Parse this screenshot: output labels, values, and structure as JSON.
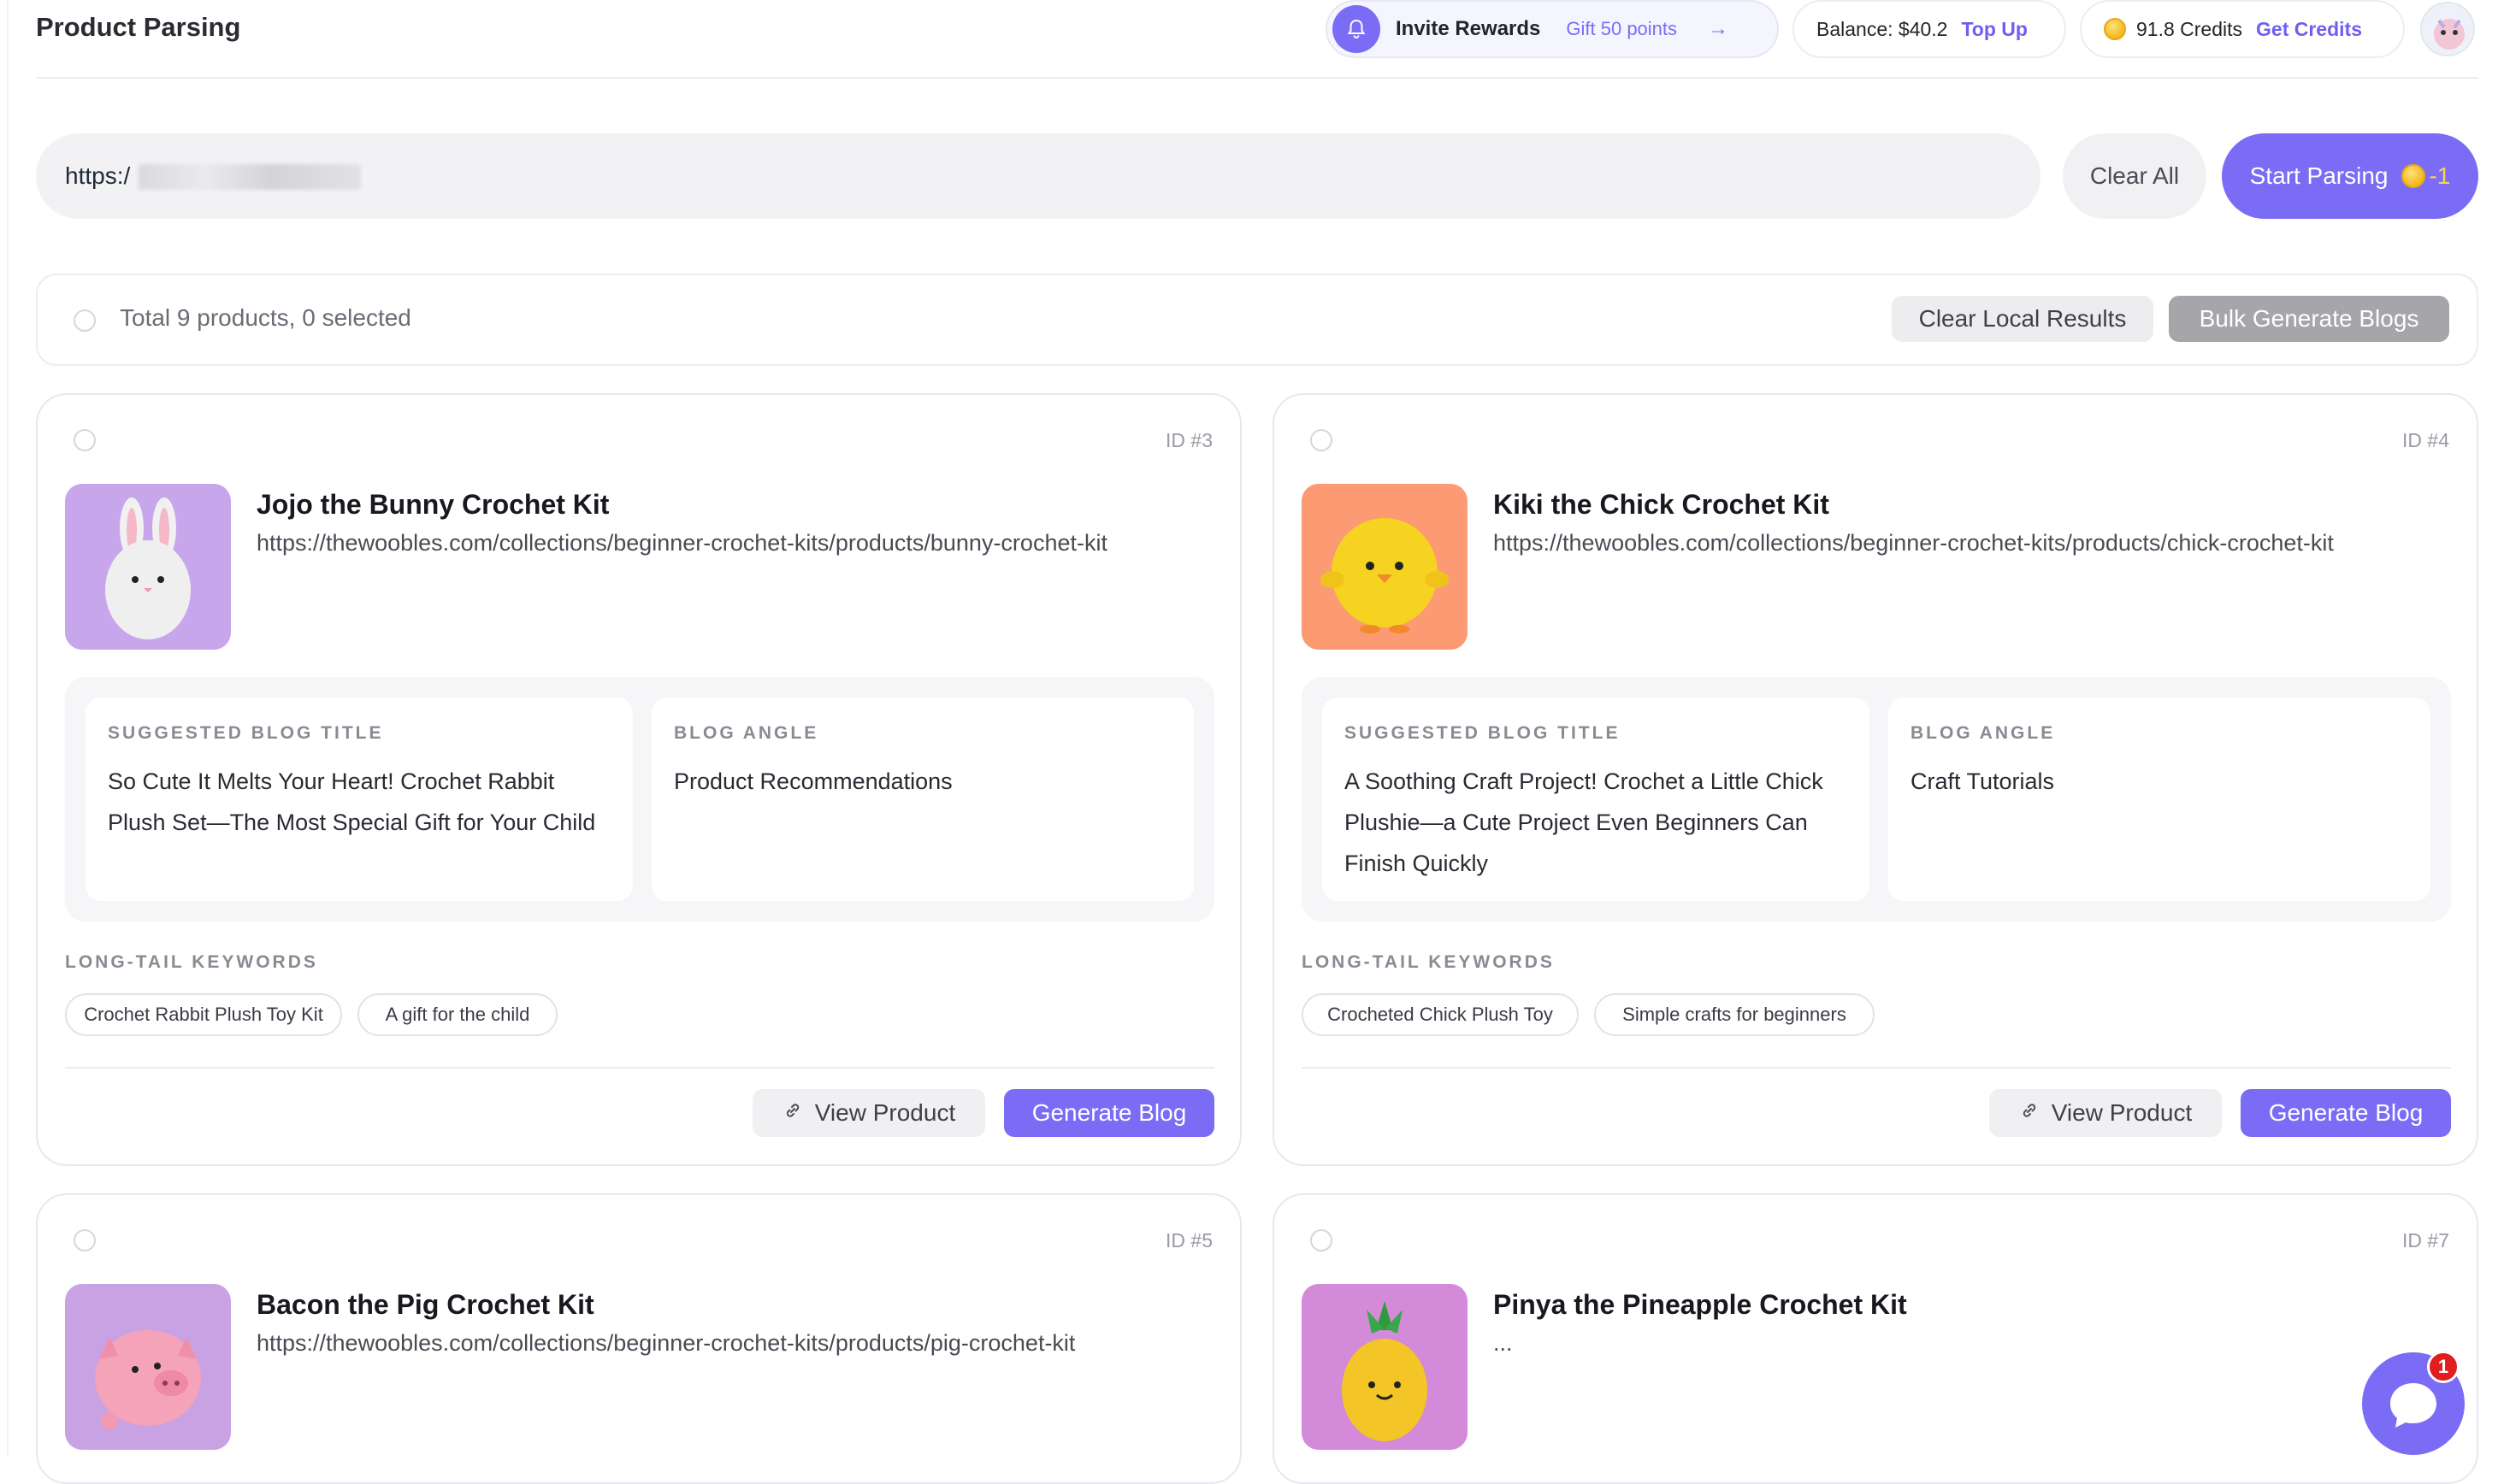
{
  "header": {
    "title": "Product Parsing",
    "invite": {
      "label": "Invite Rewards",
      "gift": "Gift 50 points"
    },
    "balance": {
      "text": "Balance: $40.2",
      "link": "Top Up"
    },
    "credits": {
      "text": "91.8 Credits",
      "link": "Get Credits"
    }
  },
  "url_bar": {
    "value": "https:/",
    "clear_all": "Clear All",
    "start_parsing": "Start Parsing",
    "cost": "-1"
  },
  "selection": {
    "summary": "Total 9 products, 0 selected",
    "clear_local": "Clear Local Results",
    "bulk_generate": "Bulk Generate Blogs"
  },
  "labels": {
    "suggested_blog_title": "SUGGESTED BLOG TITLE",
    "blog_angle": "BLOG ANGLE",
    "long_tail_keywords": "LONG-TAIL KEYWORDS",
    "view_product": "View Product",
    "generate_blog": "Generate Blog"
  },
  "products": [
    {
      "id_label": "ID #3",
      "name": "Jojo the Bunny Crochet Kit",
      "url": "https://thewoobles.com/collections/beginner-crochet-kits/products/bunny-crochet-kit",
      "suggested_title": "So Cute It Melts Your Heart! Crochet Rabbit Plush Set—The Most Special Gift for Your Child",
      "angle": "Product Recommendations",
      "keywords": [
        "Crochet Rabbit Plush Toy Kit",
        "A gift for the child"
      ],
      "image": "bunny-crochet-image",
      "bg_color": "#c8a6ec"
    },
    {
      "id_label": "ID #4",
      "name": "Kiki the Chick Crochet Kit",
      "url": "https://thewoobles.com/collections/beginner-crochet-kits/products/chick-crochet-kit",
      "suggested_title": "A Soothing Craft Project! Crochet a Little Chick Plushie—a Cute Project Even Beginners Can Finish Quickly",
      "angle": "Craft Tutorials",
      "keywords": [
        "Crocheted Chick Plush Toy",
        "Simple crafts for beginners"
      ],
      "image": "chick-crochet-image",
      "bg_color": "#fb9a73"
    },
    {
      "id_label": "ID #5",
      "name": "Bacon the Pig Crochet Kit",
      "url": "https://thewoobles.com/collections/beginner-crochet-kits/products/pig-crochet-kit",
      "image": "pig-crochet-image",
      "bg_color": "#c9a2e4"
    },
    {
      "id_label": "ID #7",
      "name": "Pinya the Pineapple Crochet Kit",
      "url": "...",
      "image": "pineapple-crochet-image",
      "bg_color": "#d28ad9"
    }
  ],
  "chat": {
    "badge": "1"
  },
  "colors": {
    "accent": "#7b6cf6",
    "link": "#6f5ff0",
    "muted_button": "#a6a6aa",
    "badge": "#e11d1d"
  }
}
